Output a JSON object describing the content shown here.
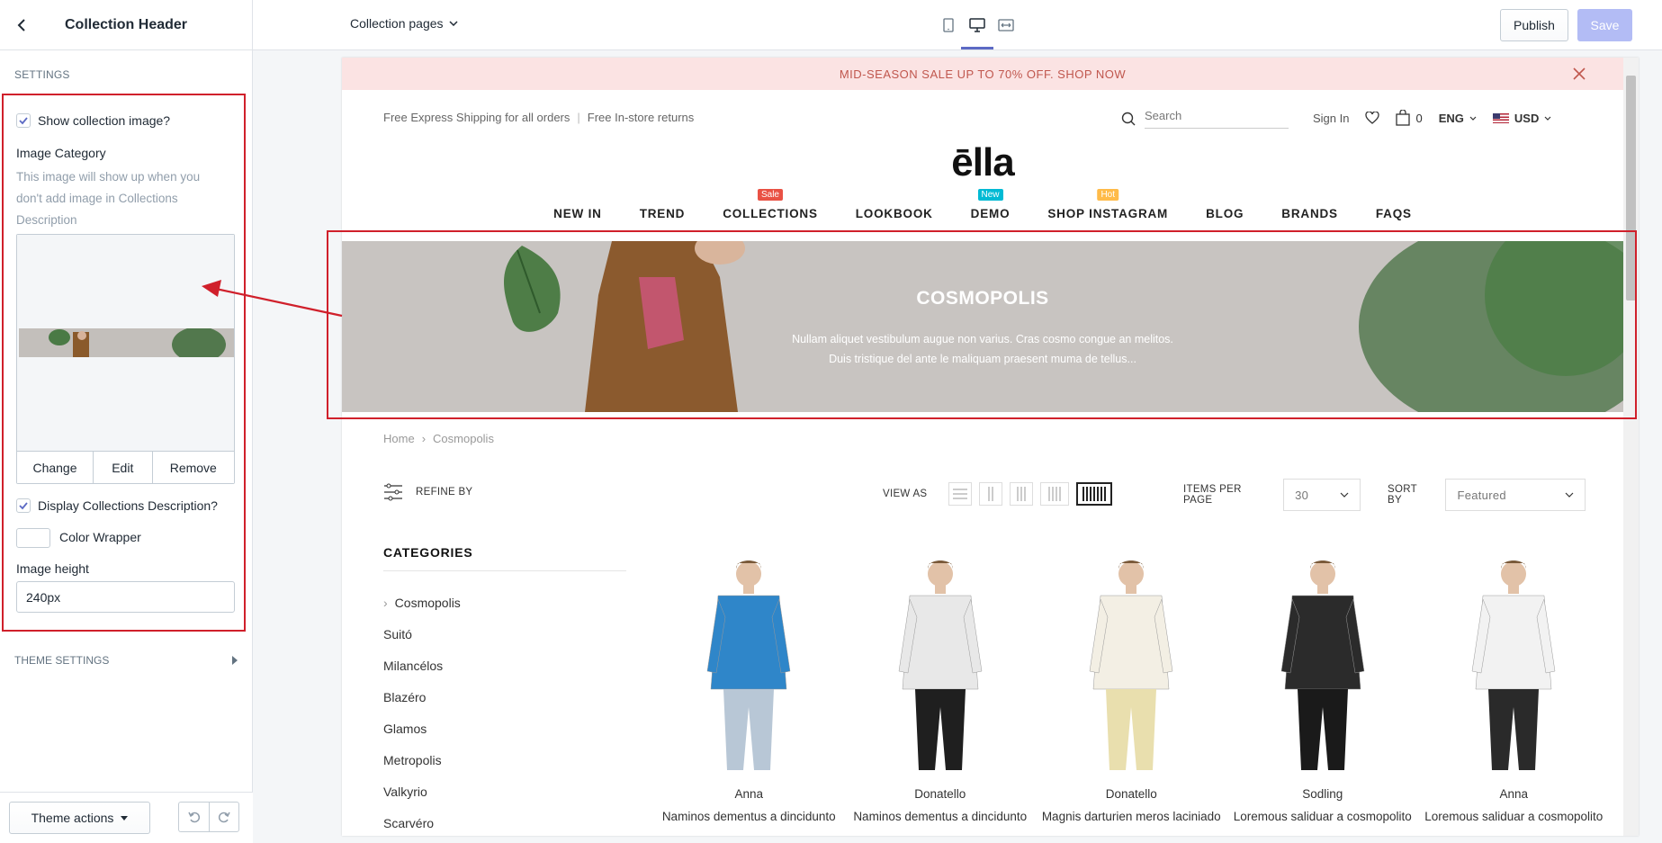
{
  "sidebar": {
    "title": "Collection Header",
    "section_label": "SETTINGS",
    "show_image_label": "Show collection image?",
    "image_category_label": "Image Category",
    "image_help": "This image will show up when you don't add image in Collections Description",
    "image_actions": [
      "Change",
      "Edit",
      "Remove"
    ],
    "display_desc_label": "Display Collections Description?",
    "color_wrapper_label": "Color Wrapper",
    "image_height_label": "Image height",
    "image_height_value": "240px",
    "theme_settings_label": "THEME SETTINGS",
    "theme_actions_label": "Theme actions"
  },
  "topbar": {
    "page_select": "Collection pages",
    "publish": "Publish",
    "save": "Save"
  },
  "store": {
    "announcement": "MID-SEASON SALE UP TO 70% OFF. SHOP NOW",
    "shipping": "Free Express Shipping for all orders",
    "returns": "Free In-store returns",
    "search_placeholder": "Search",
    "sign_in": "Sign In",
    "cart_count": "0",
    "language": "ENG",
    "currency": "USD",
    "logo": "ēlla",
    "nav": [
      {
        "label": "NEW IN"
      },
      {
        "label": "TREND"
      },
      {
        "label": "COLLECTIONS",
        "badge": "Sale",
        "badge_color": "#e95144"
      },
      {
        "label": "LOOKBOOK"
      },
      {
        "label": "DEMO",
        "badge": "New",
        "badge_color": "#01bad4"
      },
      {
        "label": "SHOP INSTAGRAM",
        "badge": "Hot",
        "badge_color": "#ffbb49"
      },
      {
        "label": "BLOG"
      },
      {
        "label": "BRANDS"
      },
      {
        "label": "FAQS"
      }
    ],
    "banner": {
      "title": "COSMOPOLIS",
      "line1": "Nullam aliquet vestibulum augue non varius. Cras cosmo congue an melitos.",
      "line2": "Duis tristique del ante le maliquam praesent muma de tellus..."
    },
    "breadcrumb": {
      "home": "Home",
      "current": "Cosmopolis"
    },
    "refine_label": "REFINE BY",
    "view_as_label": "VIEW AS",
    "items_per_page_label": "ITEMS PER PAGE",
    "items_per_page_value": "30",
    "sort_by_label": "SORT BY",
    "sort_by_value": "Featured",
    "categories_title": "CATEGORIES",
    "categories": [
      "Cosmopolis",
      "Suitó",
      "Milancélos",
      "Blazéro",
      "Glamos",
      "Metropolis",
      "Valkyrio",
      "Scarvéro"
    ],
    "products": [
      {
        "name": "Anna",
        "desc": "Naminos dementus a dincidunto",
        "shirt": "#2f86c9",
        "pants": "#b8c7d6"
      },
      {
        "name": "Donatello",
        "desc": "Naminos dementus a dincidunto",
        "shirt": "#e8e8e8",
        "pants": "#1f1f1f"
      },
      {
        "name": "Donatello",
        "desc": "Magnis darturien meros laciniado",
        "shirt": "#f3efe4",
        "pants": "#e9dfae"
      },
      {
        "name": "Sodling",
        "desc": "Loremous saliduar a cosmopolito",
        "shirt": "#2b2b2b",
        "pants": "#1a1a1a"
      },
      {
        "name": "Anna",
        "desc": "Loremous saliduar a cosmopolito",
        "shirt": "#f2f2f2",
        "pants": "#2a2a2a"
      }
    ]
  },
  "colors": {
    "accent": "#5c6ac4",
    "highlight": "#d0202b",
    "announcement_bg": "#fbe3e3"
  }
}
